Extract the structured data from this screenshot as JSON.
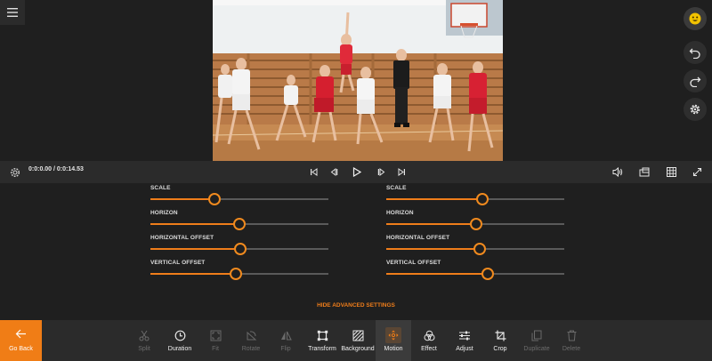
{
  "app": {
    "menu_icon": "hamburger-icon"
  },
  "right_tools": [
    {
      "name": "emoji-icon",
      "color": "#f2c200"
    },
    {
      "name": "undo-icon"
    },
    {
      "name": "redo-icon"
    },
    {
      "name": "settings-gear-icon"
    }
  ],
  "playback": {
    "timecode": "0:0:0.00 / 0:0:14.53",
    "controls": [
      "skip-to-start-icon",
      "step-back-icon",
      "play-icon",
      "step-forward-icon",
      "skip-to-end-icon"
    ],
    "right_controls": [
      "volume-icon",
      "aspect-ratio-icon",
      "grid-icon",
      "fullscreen-icon"
    ]
  },
  "motion_settings": {
    "left": [
      {
        "label": "SCALE",
        "value": 0.36
      },
      {
        "label": "HORIZON",
        "value": 0.5
      },
      {
        "label": "HORIZONTAL OFFSET",
        "value": 0.505
      },
      {
        "label": "VERTICAL OFFSET",
        "value": 0.48
      }
    ],
    "right": [
      {
        "label": "SCALE",
        "value": 0.54
      },
      {
        "label": "HORIZON",
        "value": 0.505
      },
      {
        "label": "HORIZONTAL OFFSET",
        "value": 0.525
      },
      {
        "label": "VERTICAL OFFSET",
        "value": 0.57
      }
    ],
    "hide_advanced_label": "HIDE ADVANCED SETTINGS"
  },
  "toolbar": {
    "go_back_label": "Go Back",
    "tools": [
      {
        "label": "Split",
        "icon": "scissors-icon",
        "enabled": false
      },
      {
        "label": "Duration",
        "icon": "clock-icon",
        "enabled": true
      },
      {
        "label": "Fit",
        "icon": "fit-frame-icon",
        "enabled": false
      },
      {
        "label": "Rotate",
        "icon": "rotate-icon",
        "enabled": false
      },
      {
        "label": "Flip",
        "icon": "flip-icon",
        "enabled": false
      },
      {
        "label": "Transform",
        "icon": "transform-icon",
        "enabled": true
      },
      {
        "label": "Background",
        "icon": "background-pattern-icon",
        "enabled": true
      },
      {
        "label": "Motion",
        "icon": "motion-icon",
        "enabled": true,
        "active": true
      },
      {
        "label": "Effect",
        "icon": "effect-circles-icon",
        "enabled": true
      },
      {
        "label": "Adjust",
        "icon": "sliders-icon",
        "enabled": true
      },
      {
        "label": "Crop",
        "icon": "crop-icon",
        "enabled": true
      },
      {
        "label": "Duplicate",
        "icon": "duplicate-icon",
        "enabled": false
      },
      {
        "label": "Delete",
        "icon": "trash-icon",
        "enabled": false
      }
    ]
  },
  "colors": {
    "accent": "#f07d16",
    "panel": "#2b2b2b",
    "background": "#1f1f1f"
  }
}
